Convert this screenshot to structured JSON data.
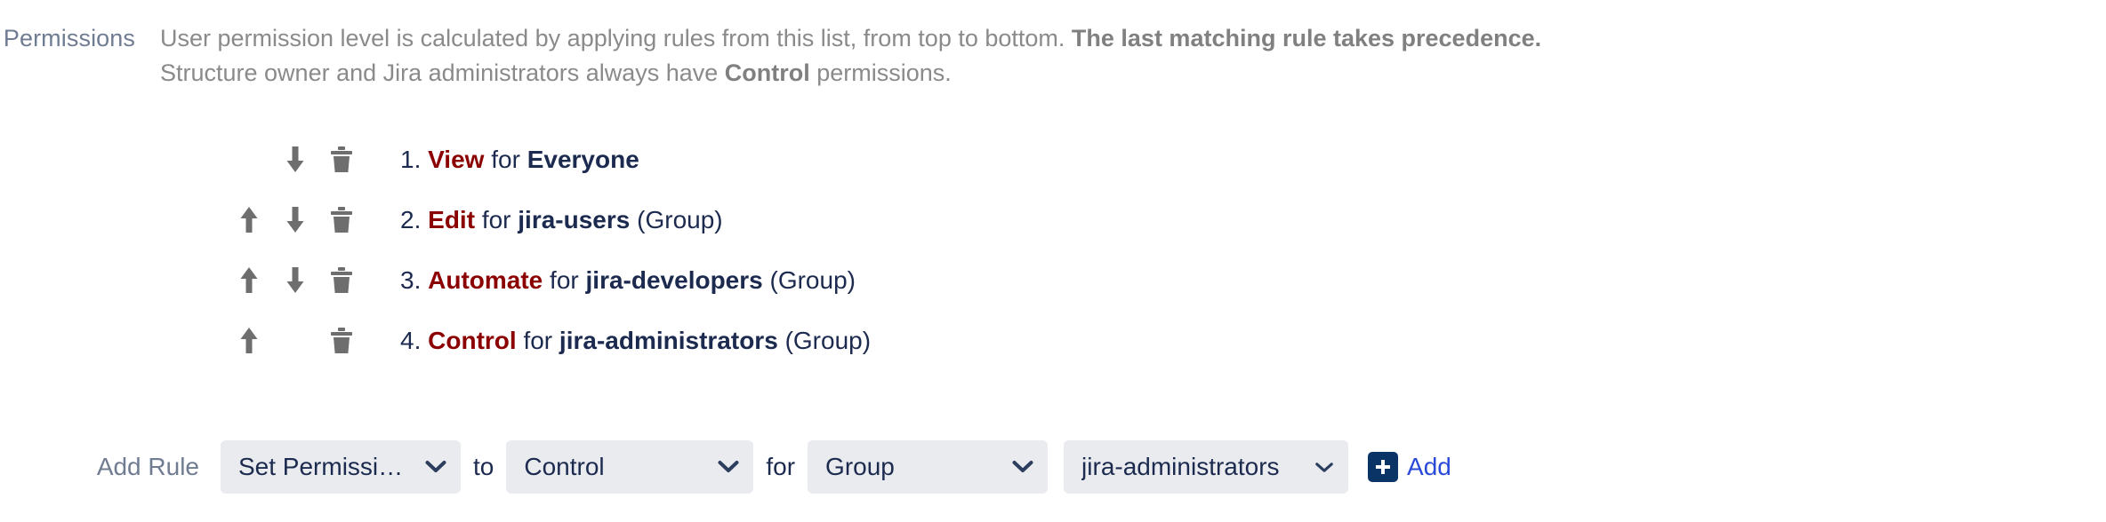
{
  "permissions": {
    "label": "Permissions",
    "description_line1_part1": "User permission level is calculated by applying rules from this list, from top to bottom. ",
    "description_line1_strong": "The last matching rule takes precedence.",
    "description_line2_part1": "Structure owner and Jira administrators always have ",
    "description_line2_strong": "Control",
    "description_line2_part2": " permissions."
  },
  "rules": [
    {
      "number": "1.",
      "level": "View",
      "for": "for",
      "subject": "Everyone",
      "kind": "",
      "move_up_icon": "arrow-up-icon",
      "move_down_icon": "arrow-down-icon",
      "delete_icon": "trash-icon",
      "has_move_up": false,
      "has_move_down": true
    },
    {
      "number": "2.",
      "level": "Edit",
      "for": "for",
      "subject": "jira-users",
      "kind": "(Group)",
      "move_up_icon": "arrow-up-icon",
      "move_down_icon": "arrow-down-icon",
      "delete_icon": "trash-icon",
      "has_move_up": true,
      "has_move_down": true
    },
    {
      "number": "3.",
      "level": "Automate",
      "for": "for",
      "subject": "jira-developers",
      "kind": "(Group)",
      "move_up_icon": "arrow-up-icon",
      "move_down_icon": "arrow-down-icon",
      "delete_icon": "trash-icon",
      "has_move_up": true,
      "has_move_down": true
    },
    {
      "number": "4.",
      "level": "Control",
      "for": "for",
      "subject": "jira-administrators",
      "kind": "(Group)",
      "move_up_icon": "arrow-up-icon",
      "move_down_icon": "arrow-down-icon",
      "delete_icon": "trash-icon",
      "has_move_up": true,
      "has_move_down": false
    }
  ],
  "add_rule": {
    "label": "Add Rule",
    "permission_type": "Set Permission Level",
    "conjunction_to": "to",
    "level": "Control",
    "conjunction_for": "for",
    "subject_type": "Group",
    "subject": "jira-administrators",
    "add_label": "Add",
    "add_icon": "plus-square-icon",
    "chevron_icon": "chevron-down-icon"
  },
  "colors": {
    "label_gray_blue": "#707c92",
    "description_gray": "#8a8a8a",
    "level_maroon": "#8b0000",
    "text_navy": "#1b2a4e",
    "select_background": "#e9ebef",
    "link_blue": "#2a4bd9",
    "add_icon_navy": "#0b3466",
    "icon_gray": "#6e6e6e"
  }
}
